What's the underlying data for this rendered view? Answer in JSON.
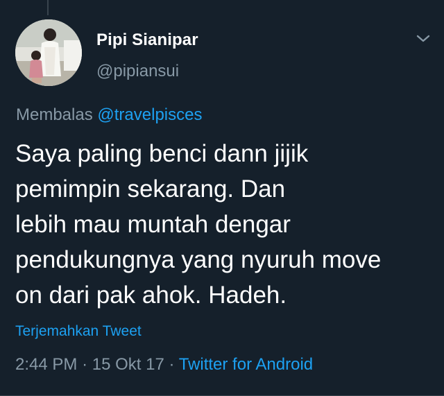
{
  "tweet": {
    "display_name": "Pipi Sianipar",
    "handle": "@pipiansui",
    "reply_prefix": "Membalas",
    "reply_mention": "@travelpisces",
    "text": "Saya paling benci dann jijik\npemimpin sekarang. Dan\nlebih mau muntah dengar\npendukungnya yang nyuruh move\non dari pak ahok. Hadeh.",
    "translate_label": "Terjemahkan Tweet",
    "time": "2:44 PM",
    "date": "15 Okt 17",
    "separator": "·",
    "source": "Twitter for Android"
  },
  "icons": {
    "menu": "chevron-down-icon",
    "avatar": "avatar"
  },
  "colors": {
    "background": "#15202b",
    "primary_text": "#ffffff",
    "secondary_text": "#8899a6",
    "accent": "#1da1f2",
    "divider": "#38444d"
  }
}
